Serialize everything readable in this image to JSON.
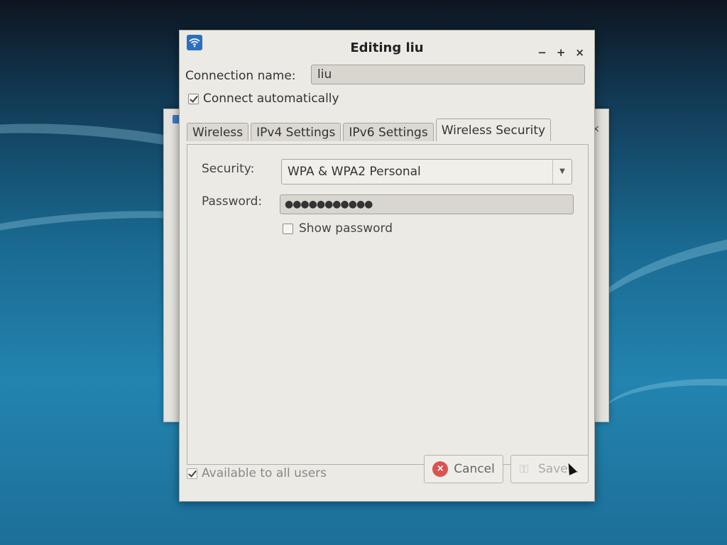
{
  "dialog": {
    "title": "Editing liu",
    "icon": "wifi-icon",
    "window_buttons": {
      "minimize": "−",
      "maximize": "+",
      "close": "×"
    }
  },
  "connection": {
    "name_label": "Connection name:",
    "name_value": "liu",
    "auto_label": "Connect automatically",
    "auto_checked": true
  },
  "tabs": [
    {
      "label": "Wireless",
      "active": false
    },
    {
      "label": "IPv4 Settings",
      "active": false
    },
    {
      "label": "IPv6 Settings",
      "active": false
    },
    {
      "label": "Wireless Security",
      "active": true
    }
  ],
  "security": {
    "security_label": "Security:",
    "security_value": "WPA & WPA2 Personal",
    "password_label": "Password:",
    "password_value": "●●●●●●●●●●●",
    "show_password_label": "Show password",
    "show_password_checked": false
  },
  "footer": {
    "all_users_label": "Available to all users",
    "all_users_checked": true,
    "cancel_label": "Cancel",
    "save_label": "Save..."
  },
  "colors": {
    "dialog_bg": "#eceae4",
    "cancel_icon": "#d9534f",
    "title_icon": "#2b6fc4"
  }
}
